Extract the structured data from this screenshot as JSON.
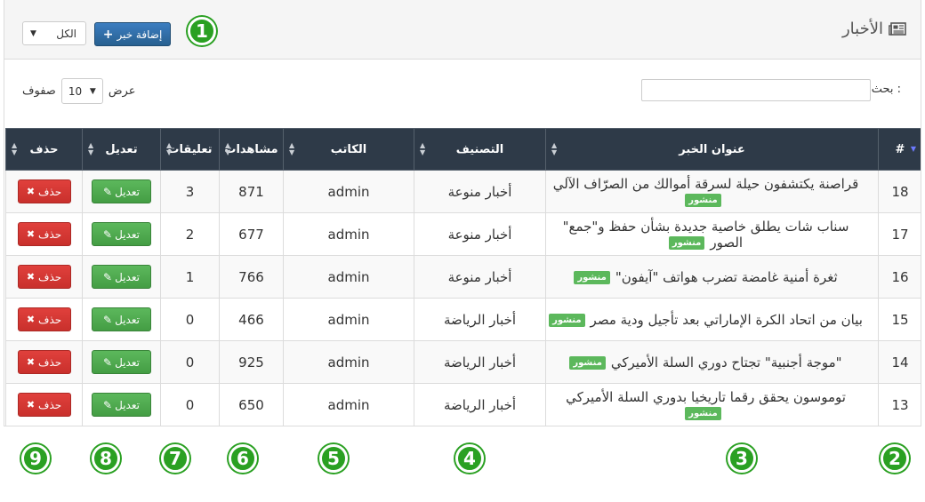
{
  "header": {
    "title": "الأخبار",
    "title_icon": "newspaper-icon",
    "add_button": "إضافة خبر",
    "filter_value": "الكل"
  },
  "search": {
    "label": "بحث :"
  },
  "length": {
    "prefix": "عرض",
    "value": "10",
    "suffix": "صفوف"
  },
  "columns": [
    "#",
    "عنوان الخبر",
    "التصنيف",
    "الكاتب",
    "مشاهدات",
    "تعليقات",
    "تعديل",
    "حذف"
  ],
  "rows": [
    {
      "id": "18",
      "title": "قراصنة يكتشفون حيلة لسرقة أموالك من الصرّاف الآلي",
      "status": "منشور",
      "category": "أخبار منوعة",
      "author": "admin",
      "views": "871",
      "comments": "3"
    },
    {
      "id": "17",
      "title": "سناب شات يطلق خاصية جديدة بشأن حفظ و\"جمع\" الصور",
      "status": "منشور",
      "category": "أخبار منوعة",
      "author": "admin",
      "views": "677",
      "comments": "2"
    },
    {
      "id": "16",
      "title": "ثغرة أمنية غامضة تضرب هواتف \"آيفون\"",
      "status": "منشور",
      "category": "أخبار منوعة",
      "author": "admin",
      "views": "766",
      "comments": "1"
    },
    {
      "id": "15",
      "title": "بيان من اتحاد الكرة الإماراتي بعد تأجيل ودية مصر",
      "status": "منشور",
      "category": "أخبار الرياضة",
      "author": "admin",
      "views": "466",
      "comments": "0"
    },
    {
      "id": "14",
      "title": "\"موجة أجنبية\" تجتاح دوري السلة الأميركي",
      "status": "منشور",
      "category": "أخبار الرياضة",
      "author": "admin",
      "views": "925",
      "comments": "0"
    },
    {
      "id": "13",
      "title": "توموسون يحقق رقما تاريخيا بدوري السلة الأميركي",
      "status": "منشور",
      "category": "أخبار الرياضة",
      "author": "admin",
      "views": "650",
      "comments": "0"
    }
  ],
  "actions": {
    "edit": "تعديل",
    "delete": "حذف"
  },
  "markers": [
    "1",
    "2",
    "3",
    "4",
    "5",
    "6",
    "7",
    "8",
    "9"
  ],
  "colors": {
    "header_bg": "#2e3a48",
    "primary": "#286090",
    "success": "#5cb85c",
    "danger": "#d9534f",
    "marker": "#2aa022"
  }
}
